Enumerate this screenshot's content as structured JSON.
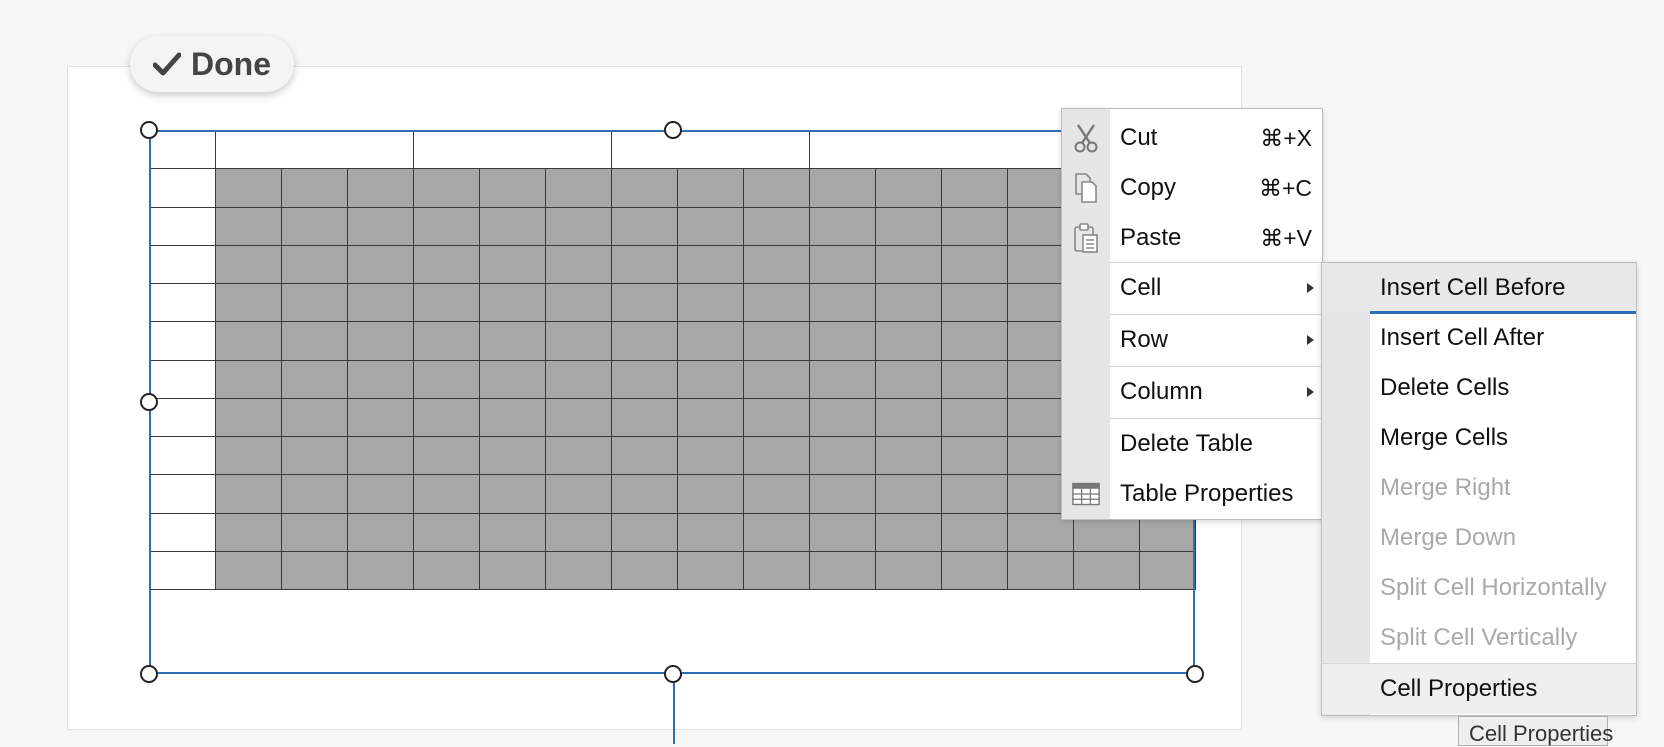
{
  "toolbar": {
    "done_label": "Done",
    "done_icon": "check-icon"
  },
  "table": {
    "header_row_cells": 5,
    "body_rows": 11,
    "body_columns": 15,
    "selected_region": "rows 2-12, columns 2-15"
  },
  "context_menu": {
    "items": [
      {
        "label": "Cut",
        "shortcut": "⌘+X",
        "icon": "scissors-icon"
      },
      {
        "label": "Copy",
        "shortcut": "⌘+C",
        "icon": "copy-icon"
      },
      {
        "label": "Paste",
        "shortcut": "⌘+V",
        "icon": "paste-icon"
      },
      {
        "label": "Cell",
        "submenu": true
      },
      {
        "label": "Row",
        "submenu": true
      },
      {
        "label": "Column",
        "submenu": true
      },
      {
        "label": "Delete Table"
      },
      {
        "label": "Table Properties",
        "icon": "table-icon"
      }
    ]
  },
  "cell_submenu": {
    "items": [
      {
        "label": "Insert Cell Before",
        "enabled": true,
        "highlighted": true
      },
      {
        "label": "Insert Cell After",
        "enabled": true
      },
      {
        "label": "Delete Cells",
        "enabled": true
      },
      {
        "label": "Merge Cells",
        "enabled": true
      },
      {
        "label": "Merge Right",
        "enabled": false
      },
      {
        "label": "Merge Down",
        "enabled": false
      },
      {
        "label": "Split Cell Horizontally",
        "enabled": false
      },
      {
        "label": "Split Cell Vertically",
        "enabled": false
      },
      {
        "label": "Cell Properties",
        "enabled": true
      }
    ]
  },
  "tooltip": {
    "text": "Cell Properties"
  },
  "colors": {
    "accent": "#2f6db5",
    "selected_cell": "#a8a8a8",
    "disabled_text": "#a9a9a9"
  }
}
